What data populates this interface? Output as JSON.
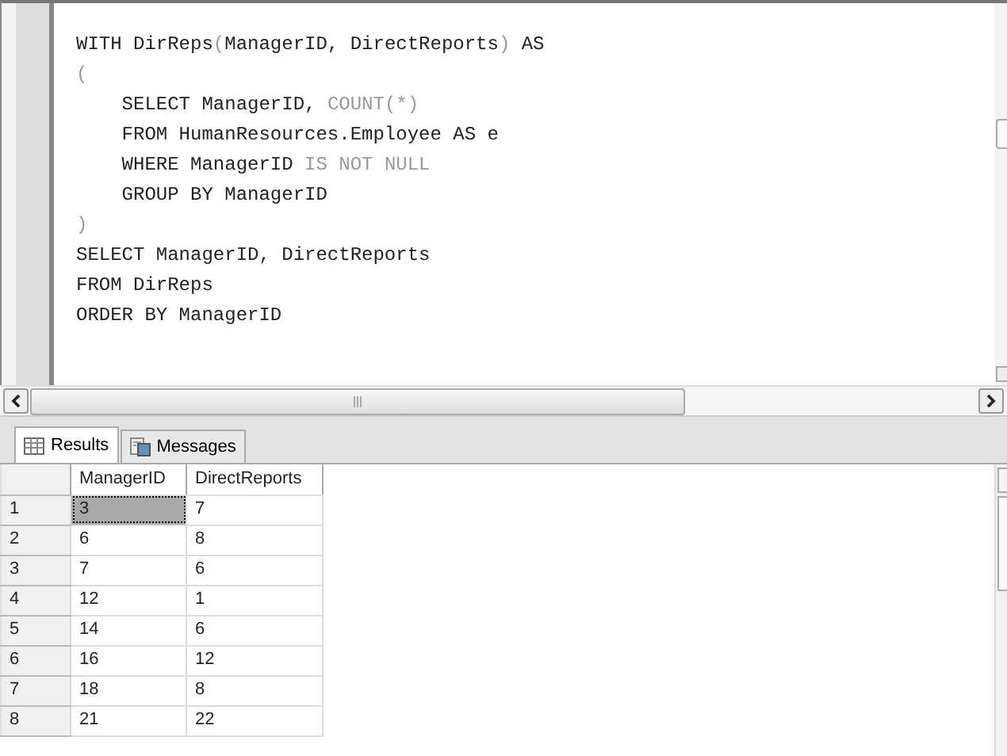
{
  "editor": {
    "lines": [
      [
        {
          "text": "WITH DirReps",
          "kind": "code"
        },
        {
          "text": "(",
          "kind": "muted"
        },
        {
          "text": "ManagerID, DirectReports",
          "kind": "code"
        },
        {
          "text": ")",
          "kind": "muted"
        },
        {
          "text": " AS",
          "kind": "code"
        }
      ],
      [
        {
          "text": "(",
          "kind": "muted"
        }
      ],
      [
        {
          "text": "    SELECT ManagerID, ",
          "kind": "code"
        },
        {
          "text": "COUNT(*)",
          "kind": "muted"
        }
      ],
      [
        {
          "text": "    FROM HumanResources.Employee AS e",
          "kind": "code"
        }
      ],
      [
        {
          "text": "    WHERE ManagerID ",
          "kind": "code"
        },
        {
          "text": "IS NOT NULL",
          "kind": "muted"
        }
      ],
      [
        {
          "text": "    GROUP BY ManagerID",
          "kind": "code"
        }
      ],
      [
        {
          "text": ")",
          "kind": "muted"
        }
      ],
      [
        {
          "text": "SELECT ManagerID, DirectReports",
          "kind": "code"
        }
      ],
      [
        {
          "text": "FROM DirReps",
          "kind": "code"
        }
      ],
      [
        {
          "text": "ORDER BY ManagerID",
          "kind": "code"
        }
      ]
    ]
  },
  "tabs": [
    {
      "label": "Results",
      "kind": "grid",
      "selected": true
    },
    {
      "label": "Messages",
      "kind": "messages",
      "selected": false
    }
  ],
  "results": {
    "columns": [
      "ManagerID",
      "DirectReports"
    ],
    "rows": [
      {
        "number": "1",
        "cells": [
          {
            "text": "3",
            "selected": true
          },
          {
            "text": "7",
            "selected": false
          }
        ]
      },
      {
        "number": "2",
        "cells": [
          {
            "text": "6",
            "selected": false
          },
          {
            "text": "8",
            "selected": false
          }
        ]
      },
      {
        "number": "3",
        "cells": [
          {
            "text": "7",
            "selected": false
          },
          {
            "text": "6",
            "selected": false
          }
        ]
      },
      {
        "number": "4",
        "cells": [
          {
            "text": "12",
            "selected": false
          },
          {
            "text": "1",
            "selected": false
          }
        ]
      },
      {
        "number": "5",
        "cells": [
          {
            "text": "14",
            "selected": false
          },
          {
            "text": "6",
            "selected": false
          }
        ]
      },
      {
        "number": "6",
        "cells": [
          {
            "text": "16",
            "selected": false
          },
          {
            "text": "12",
            "selected": false
          }
        ]
      },
      {
        "number": "7",
        "cells": [
          {
            "text": "18",
            "selected": false
          },
          {
            "text": "8",
            "selected": false
          }
        ]
      },
      {
        "number": "8",
        "cells": [
          {
            "text": "21",
            "selected": false
          },
          {
            "text": "22",
            "selected": false
          }
        ]
      }
    ]
  }
}
